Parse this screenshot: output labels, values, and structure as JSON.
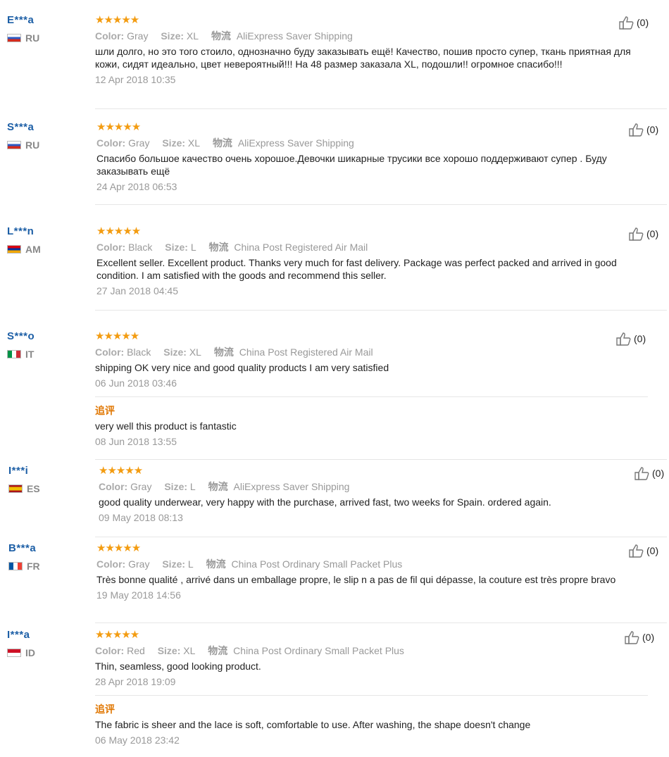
{
  "reviews": [
    {
      "user": "E***a",
      "country": "RU",
      "flag": "ru",
      "stars": "★★★★★",
      "color_label": "Color:",
      "color": "Gray",
      "size_label": "Size:",
      "size": "XL",
      "ship_label": "物流",
      "shipping": "AliExpress Saver Shipping",
      "text": "шли долго, но это того стоило, однозначно буду заказывать ещё! Качество, пошив просто супер, ткань приятная для кожи, сидят идеально, цвет невероятный!!! На 48 размер заказала XL, подошли!! огромное спасибо!!!",
      "date": "12 Apr 2018 10:35",
      "helpful": "(0)"
    },
    {
      "user": "S***a",
      "country": "RU",
      "flag": "ru",
      "stars": "★★★★★",
      "color_label": "Color:",
      "color": "Gray",
      "size_label": "Size:",
      "size": "XL",
      "ship_label": "物流",
      "shipping": "AliExpress Saver Shipping",
      "text": "Спасибо большое качество очень хорошое.Девочки шикарные трусики все хорошо поддерживают супер . Буду заказывать ещё",
      "date": "24 Apr 2018 06:53",
      "helpful": "(0)"
    },
    {
      "user": "L***n",
      "country": "AM",
      "flag": "am",
      "stars": "★★★★★",
      "color_label": "Color:",
      "color": "Black",
      "size_label": "Size:",
      "size": "L",
      "ship_label": "物流",
      "shipping": "China Post Registered Air Mail",
      "text": "Excellent seller. Excellent product. Thanks very much for fast delivery. Package was perfect packed and arrived in good condition. I am satisfied with the goods and recommend this seller.",
      "date": "27 Jan 2018 04:45",
      "helpful": "(0)"
    },
    {
      "user": "S***o",
      "country": "IT",
      "flag": "it",
      "stars": "★★★★★",
      "color_label": "Color:",
      "color": "Black",
      "size_label": "Size:",
      "size": "XL",
      "ship_label": "物流",
      "shipping": "China Post Registered Air Mail",
      "text": "shipping OK very nice and good quality products I am very satisfied",
      "date": "06 Jun 2018 03:46",
      "helpful": "(0)",
      "additional_label": "追评",
      "additional_text": "very well this product is fantastic",
      "additional_date": "08 Jun 2018 13:55"
    },
    {
      "user": "I***i",
      "country": "ES",
      "flag": "es",
      "stars": "★★★★★",
      "color_label": "Color:",
      "color": "Gray",
      "size_label": "Size:",
      "size": "L",
      "ship_label": "物流",
      "shipping": "AliExpress Saver Shipping",
      "text": "good quality underwear, very happy with the purchase, arrived fast, two weeks for Spain. ordered again.",
      "date": "09 May 2018 08:13",
      "helpful": "(0)"
    },
    {
      "user": "B***a",
      "country": "FR",
      "flag": "fr",
      "stars": "★★★★★",
      "color_label": "Color:",
      "color": "Gray",
      "size_label": "Size:",
      "size": "L",
      "ship_label": "物流",
      "shipping": "China Post Ordinary Small Packet Plus",
      "text": "Très bonne qualité , arrivé dans un emballage propre, le slip n a pas de fil qui dépasse, la couture est très propre bravo",
      "date": "19 May 2018 14:56",
      "helpful": "(0)"
    },
    {
      "user": "I***a",
      "country": "ID",
      "flag": "id",
      "stars": "★★★★★",
      "color_label": "Color:",
      "color": "Red",
      "size_label": "Size:",
      "size": "XL",
      "ship_label": "物流",
      "shipping": "China Post Ordinary Small Packet Plus",
      "text": "Thin, seamless, good looking product.",
      "date": "28 Apr 2018 19:09",
      "helpful": "(0)",
      "additional_label": "追评",
      "additional_text": "The fabric is sheer and the lace is soft, comfortable to use. After washing, the shape doesn't change",
      "additional_date": "06 May 2018 23:42"
    }
  ]
}
